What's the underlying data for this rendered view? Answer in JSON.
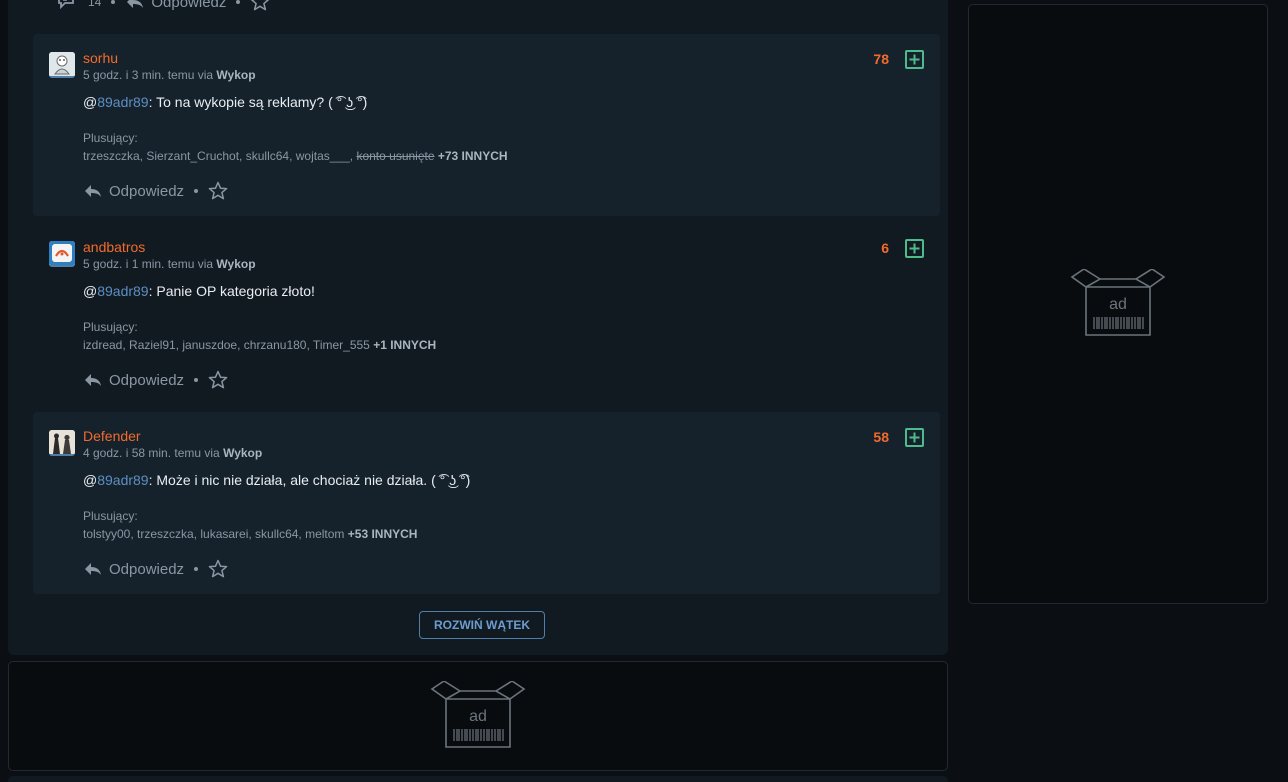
{
  "thread_top": {
    "reply_count": "14",
    "reply_label": "Odpowiedz"
  },
  "comments": [
    {
      "username": "sorhu",
      "time": "5 godz. i 3 min. temu via",
      "via": "Wykop",
      "mention": "89adr89",
      "text": ": To na wykopie są reklamy? ( ͡° ͜ʖ ͡°)",
      "score": "78",
      "plus_label": "Plusujący:",
      "plus_users": "trzeszczka, Sierzant_Cruchot, skullc64, wojtas___, ",
      "plus_deleted": "konto usunięte",
      "plus_more": "+73 INNYCH",
      "reply_label": "Odpowiedz",
      "avatar_color": "#dfe7ea"
    },
    {
      "username": "andbatros",
      "time": "5 godz. i 1 min. temu via",
      "via": "Wykop",
      "mention": "89adr89",
      "text": ": Panie OP kategoria złoto!",
      "score": "6",
      "plus_label": "Plusujący:",
      "plus_users": "izdread, Raziel91, januszdoe, chrzanu180, Timer_555 ",
      "plus_deleted": "",
      "plus_more": "+1 INNYCH",
      "reply_label": "Odpowiedz",
      "avatar_color": "#2e7fc0"
    },
    {
      "username": "Defender",
      "time": "4 godz. i 58 min. temu via",
      "via": "Wykop",
      "mention": "89adr89",
      "text": ": Może i nic nie działa, ale chociaż nie działa. ( ͡° ͜ʖ ͡°)",
      "score": "58",
      "plus_label": "Plusujący:",
      "plus_users": "tolstyy00, trzeszczka, lukasarei, skullc64, meltom ",
      "plus_deleted": "",
      "plus_more": "+53 INNYCH",
      "reply_label": "Odpowiedz",
      "avatar_color": "#3a3a3a"
    }
  ],
  "expand_button": "ROZWIŃ WĄTEK",
  "ads": {
    "label": "ad"
  },
  "colors": {
    "username": "#f26b2d",
    "score": "#f26b2d",
    "mention": "#5d8fc3",
    "plus_button": "#4dbb8a",
    "background": "#0b0e12"
  }
}
